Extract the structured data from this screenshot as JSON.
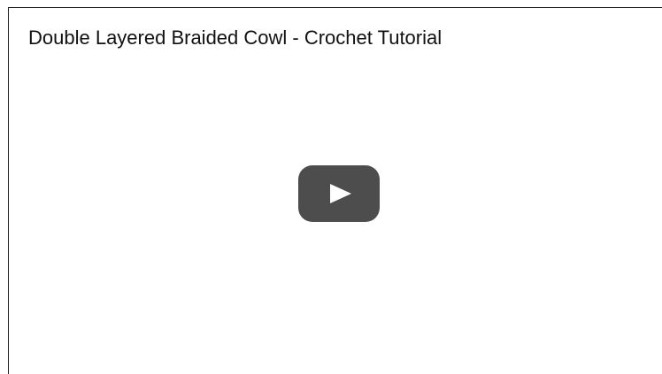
{
  "video": {
    "title": "Double Layered Braided Cowl - Crochet Tutorial"
  },
  "player": {
    "play_icon": "play-icon",
    "play_button_color": "#4d4d4d",
    "play_icon_color": "#ffffff"
  }
}
